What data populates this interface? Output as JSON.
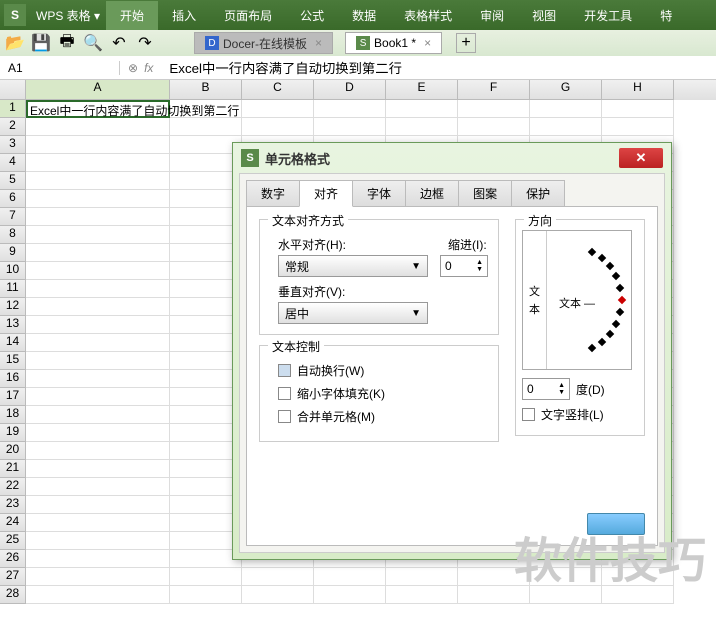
{
  "app": {
    "logo": "S",
    "name": "WPS 表格",
    "dropdown": "▾"
  },
  "ribbon": [
    "开始",
    "插入",
    "页面布局",
    "公式",
    "数据",
    "表格样式",
    "审阅",
    "视图",
    "开发工具",
    "特"
  ],
  "ribbon_active_index": 0,
  "doc_tabs": {
    "tab1": {
      "icon": "D",
      "label": "Docer-在线模板"
    },
    "tab2": {
      "icon": "S",
      "label": "Book1 *"
    }
  },
  "formula": {
    "name_box": "A1",
    "fx": "fx",
    "value": "Excel中一行内容满了自动切换到第二行"
  },
  "grid": {
    "columns": [
      "A",
      "B",
      "C",
      "D",
      "E",
      "F",
      "G",
      "H"
    ],
    "rows": 28,
    "cell_a1": "Excel中一行内容满了自动切换到第二行"
  },
  "dialog": {
    "title": "单元格格式",
    "tabs": [
      "数字",
      "对齐",
      "字体",
      "边框",
      "图案",
      "保护"
    ],
    "active_tab": 1,
    "align_section": "文本对齐方式",
    "h_label": "水平对齐(H):",
    "h_value": "常规",
    "indent_label": "缩进(I):",
    "indent_value": "0",
    "v_label": "垂直对齐(V):",
    "v_value": "居中",
    "ctrl_section": "文本控制",
    "wrap": "自动换行(W)",
    "shrink": "缩小字体填充(K)",
    "merge": "合并单元格(M)",
    "orient_section": "方向",
    "orient_vert": "文本",
    "orient_text": "文本 —",
    "deg_value": "0",
    "deg_label": "度(D)",
    "vert_text": "文字竖排(L)"
  },
  "watermark": "软件技巧"
}
